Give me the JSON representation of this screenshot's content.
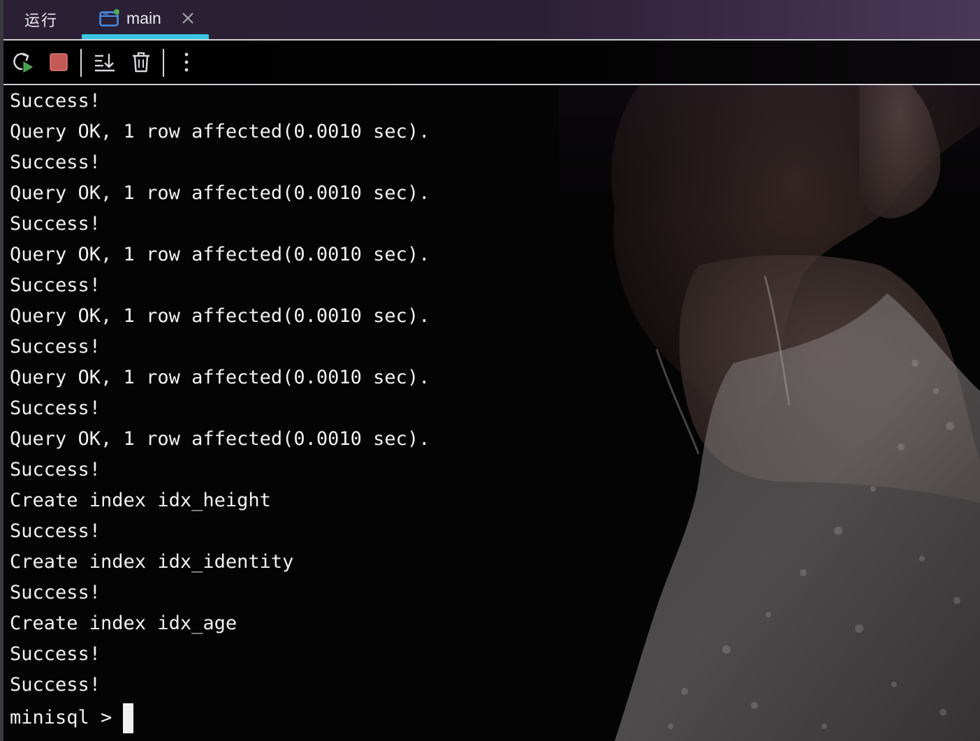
{
  "tabs": {
    "run_label": "运行",
    "active_tab_label": "main"
  },
  "toolbar": {
    "buttons": [
      {
        "icon": "rerun-icon"
      },
      {
        "icon": "stop-icon"
      },
      {
        "icon": "scroll-to-end-icon"
      },
      {
        "icon": "trash-icon"
      },
      {
        "icon": "more-vertical-icon"
      }
    ]
  },
  "console": {
    "lines": [
      "Success!",
      "Query OK, 1 row affected(0.0010 sec).",
      "Success!",
      "Query OK, 1 row affected(0.0010 sec).",
      "Success!",
      "Query OK, 1 row affected(0.0010 sec).",
      "Success!",
      "Query OK, 1 row affected(0.0010 sec).",
      "Success!",
      "Query OK, 1 row affected(0.0010 sec).",
      "Success!",
      "Query OK, 1 row affected(0.0010 sec).",
      "Success!",
      "Create index idx_height",
      "Success!",
      "Create index idx_identity",
      "Success!",
      "Create index idx_age",
      "Success!",
      "Success!"
    ],
    "prompt": "minisql >"
  },
  "colors": {
    "accent": "#38c6e2",
    "stop": "#d9534f",
    "run_green": "#4caf50",
    "background": "#000000",
    "text": "#f2f2f2"
  }
}
